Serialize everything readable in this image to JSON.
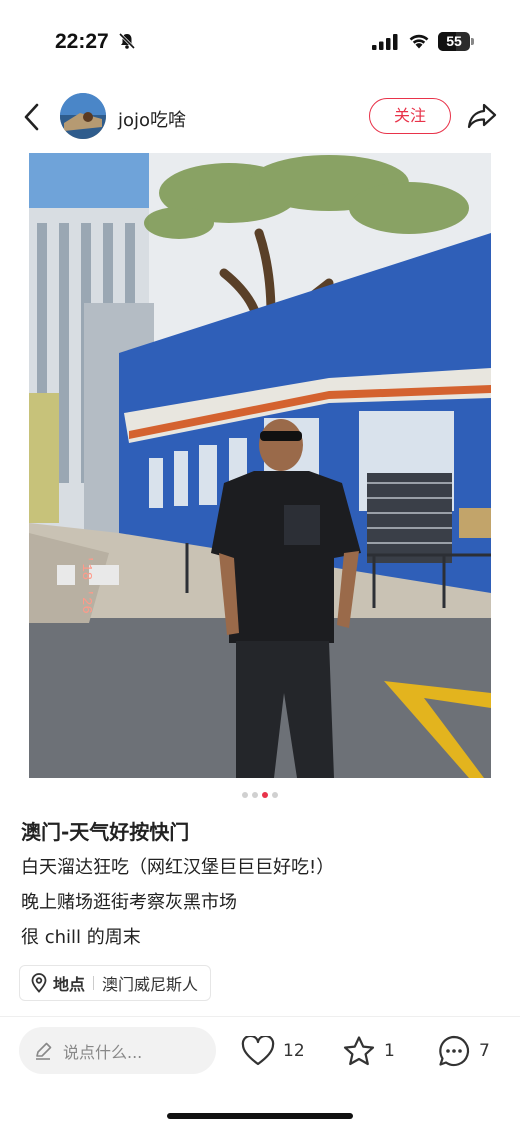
{
  "status_bar": {
    "time": "22:27",
    "battery_level": "55",
    "battery_fraction": 0.55,
    "icons": [
      "bell-slash-icon",
      "signal-icon",
      "wifi-icon",
      "battery-icon"
    ]
  },
  "nav": {
    "back_icon": "chevron-left-icon",
    "author_name": "jojo吃啥",
    "follow_label": "关注",
    "share_icon": "share-icon"
  },
  "carousel": {
    "total": 4,
    "active_index": 2,
    "photo_stamp": "'18 '26"
  },
  "note": {
    "title": "澳门-天气好按快门",
    "lines": [
      "白天溜达狂吃（网红汉堡巨巨巨好吃!）",
      "晚上赌场逛街考察灰黑市场",
      "很 chill 的周末"
    ]
  },
  "location": {
    "key": "地点",
    "value": "澳门威尼斯人",
    "icon": "location-pin-icon"
  },
  "bottom_bar": {
    "comment_placeholder": "说点什么...",
    "likes": "12",
    "collects": "1",
    "comments": "7"
  },
  "colors": {
    "accent": "#e8334a",
    "text": "#222222",
    "muted": "#888888"
  }
}
